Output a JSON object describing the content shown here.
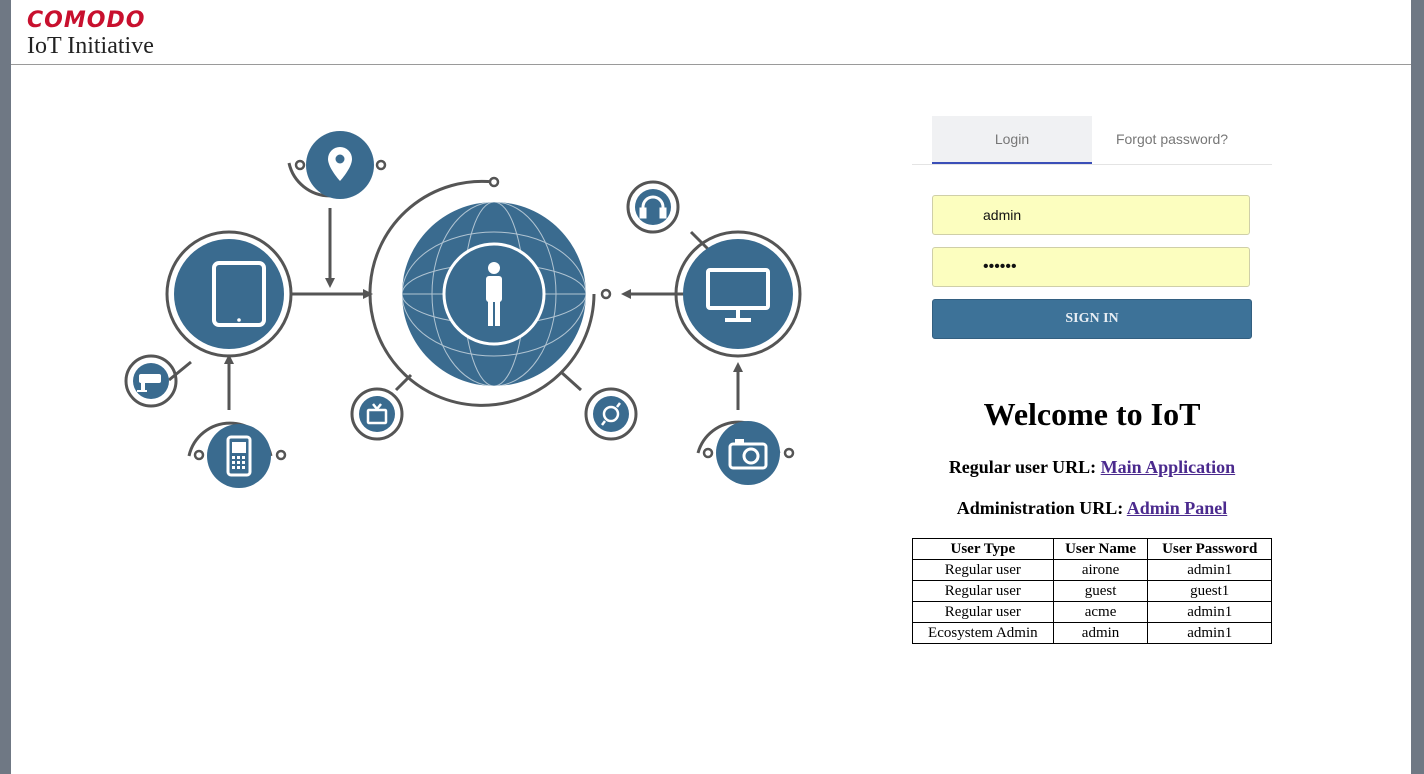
{
  "header": {
    "brand": "COMODO",
    "subtitle": "IoT Initiative"
  },
  "tabs": {
    "login": "Login",
    "forgot": "Forgot password?"
  },
  "form": {
    "username_value": "admin",
    "password_value": "••••••",
    "signin_label": "SIGN IN"
  },
  "welcome": {
    "title": "Welcome to IoT",
    "regular_prefix": "Regular user URL:",
    "regular_link": "Main Application",
    "admin_prefix": "Administration URL:",
    "admin_link": "Admin Panel"
  },
  "table": {
    "headers": [
      "User Type",
      "User Name",
      "User Password"
    ],
    "rows": [
      [
        "Regular user",
        "airone",
        "admin1"
      ],
      [
        "Regular user",
        "guest",
        "guest1"
      ],
      [
        "Regular user",
        "acme",
        "admin1"
      ],
      [
        "Ecosystem Admin",
        "admin",
        "admin1"
      ]
    ]
  },
  "colors": {
    "brand_red": "#c8102e",
    "accent_blue": "#3d7298",
    "node_blue": "#3a6b8f",
    "input_yellow": "#fcfebf",
    "link_purple": "#4b2a8e"
  },
  "illustration_icons": [
    "location-pin-icon",
    "tablet-icon",
    "globe-person-icon",
    "monitor-icon",
    "headphones-icon",
    "cctv-icon",
    "mobile-phone-icon",
    "tv-icon",
    "watch-icon",
    "camera-icon"
  ]
}
